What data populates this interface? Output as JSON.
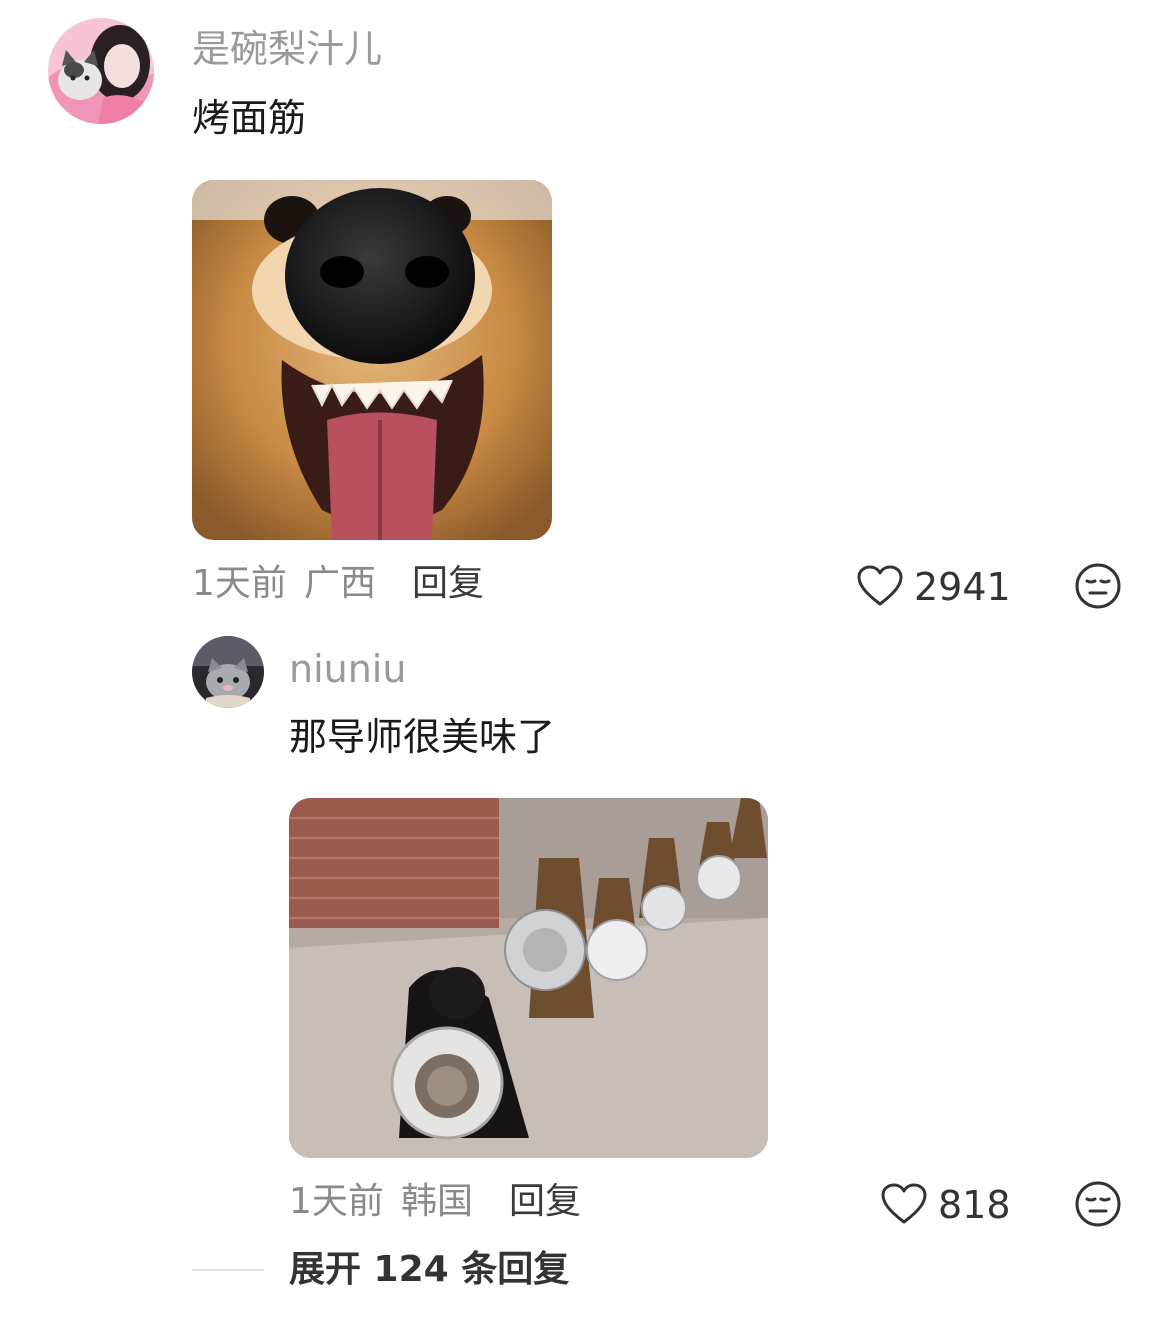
{
  "comments": [
    {
      "username": "是碗梨汁儿",
      "text": "烤面筋",
      "time": "1天前",
      "location": "广西",
      "reply_label": "回复",
      "likes": "2941",
      "image_desc": "dog-closeup-photo",
      "avatar_desc": "anime-girl-with-cat-avatar"
    },
    {
      "username": "niuniu",
      "text": "那导师很美味了",
      "time": "1天前",
      "location": "韩国",
      "reply_label": "回复",
      "likes": "818",
      "image_desc": "dogs-holding-bowls-photo",
      "avatar_desc": "cat-avatar"
    }
  ],
  "expand_replies": "展开 124 条回复",
  "colors": {
    "username": "#9a9a9a",
    "meta": "#8a8a8a",
    "text": "#1a1a1a"
  },
  "icons": [
    "heart-icon",
    "dislike-face-icon"
  ]
}
